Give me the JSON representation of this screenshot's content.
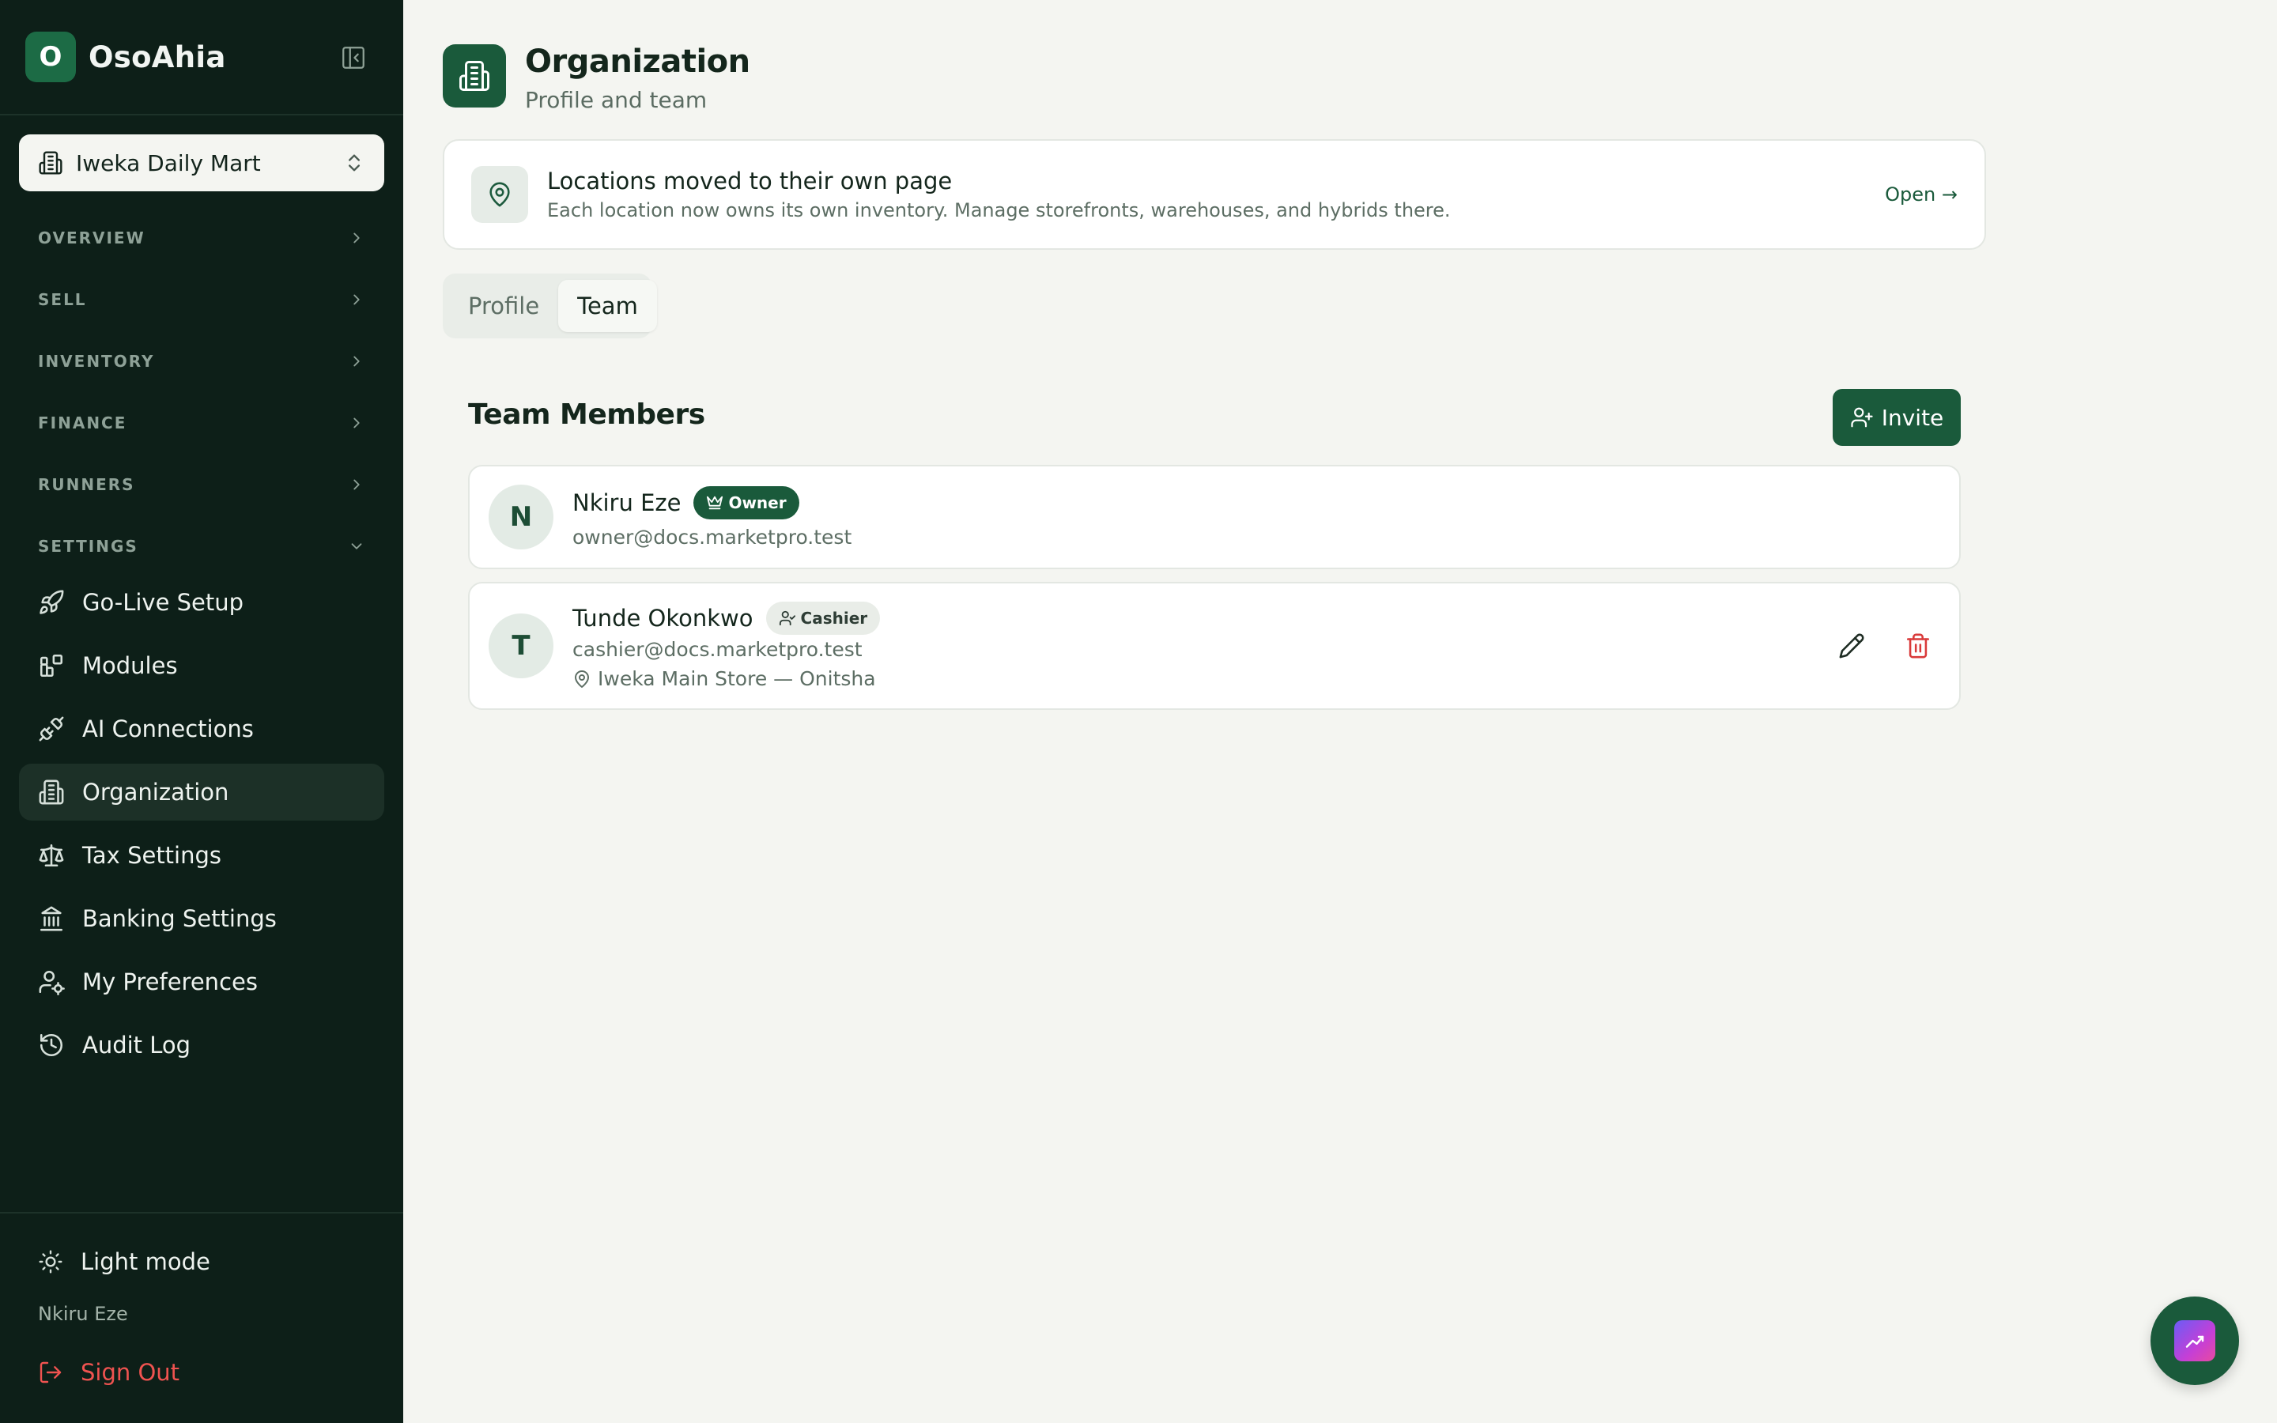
{
  "app": {
    "brand_initial": "O",
    "brand_name": "OsoAhia"
  },
  "sidebar": {
    "store_name": "Iweka Daily Mart",
    "groups": [
      {
        "label": "OVERVIEW",
        "state": "collapsed"
      },
      {
        "label": "SELL",
        "state": "collapsed"
      },
      {
        "label": "INVENTORY",
        "state": "collapsed"
      },
      {
        "label": "FINANCE",
        "state": "collapsed"
      },
      {
        "label": "RUNNERS",
        "state": "collapsed"
      },
      {
        "label": "SETTINGS",
        "state": "expanded"
      }
    ],
    "items": [
      {
        "label": "Go-Live Setup",
        "icon": "rocket-icon"
      },
      {
        "label": "Modules",
        "icon": "modules-icon"
      },
      {
        "label": "AI Connections",
        "icon": "plug-icon"
      },
      {
        "label": "Organization",
        "icon": "building-icon",
        "active": true
      },
      {
        "label": "Tax Settings",
        "icon": "scale-icon"
      },
      {
        "label": "Banking Settings",
        "icon": "bank-icon"
      },
      {
        "label": "My Preferences",
        "icon": "user-settings-icon"
      },
      {
        "label": "Audit Log",
        "icon": "history-icon"
      }
    ],
    "footer": {
      "theme_label": "Light mode",
      "user_name": "Nkiru Eze",
      "sign_out_label": "Sign Out"
    }
  },
  "header": {
    "title": "Organization",
    "subtitle": "Profile and team"
  },
  "notice": {
    "title": "Locations moved to their own page",
    "description": "Each location now owns its own inventory. Manage storefronts, warehouses, and hybrids there.",
    "link_label": "Open →"
  },
  "tabs": [
    {
      "label": "Profile",
      "active": false
    },
    {
      "label": "Team",
      "active": true
    }
  ],
  "team": {
    "title": "Team Members",
    "invite_label": "Invite",
    "members": [
      {
        "initial": "N",
        "name": "Nkiru Eze",
        "role": "Owner",
        "email": "owner@docs.marketpro.test"
      },
      {
        "initial": "T",
        "name": "Tunde Okonkwo",
        "role": "Cashier",
        "email": "cashier@docs.marketpro.test",
        "location": "Iweka Main Store — Onitsha"
      }
    ]
  },
  "colors": {
    "sidebar_bg": "#0d1f18",
    "accent": "#1a5a3b",
    "danger": "#d93a3a",
    "page_bg": "#f4f5f1"
  }
}
